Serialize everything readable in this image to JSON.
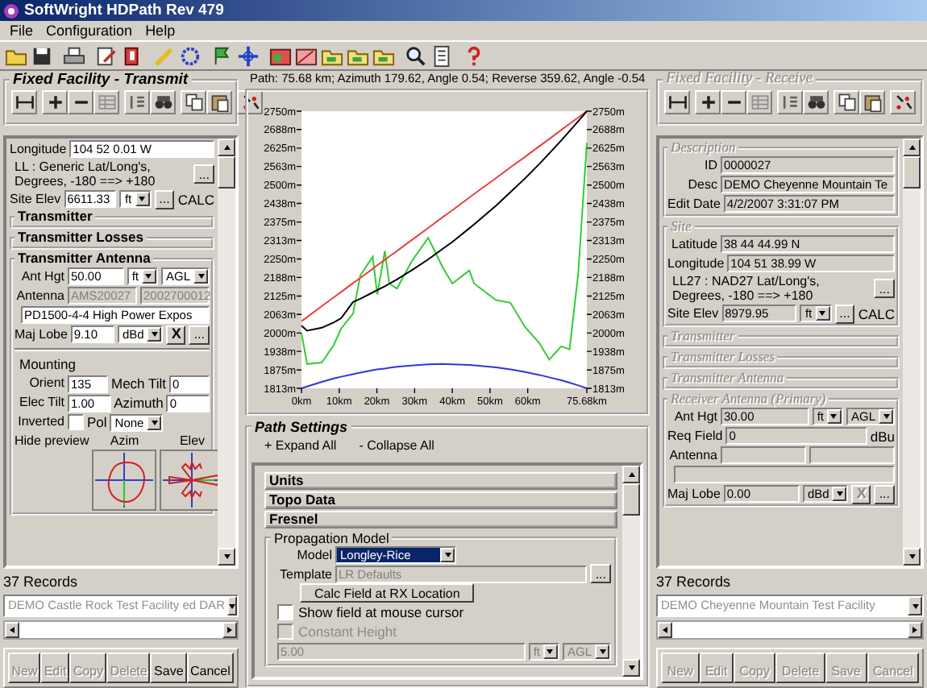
{
  "window": {
    "title": "SoftWright HDPath Rev 479"
  },
  "menu": [
    {
      "label": "File"
    },
    {
      "label": "Configuration"
    },
    {
      "label": "Help"
    }
  ],
  "transmit": {
    "title": "Fixed Facility - Transmit",
    "disabled": false,
    "blocks": [
      {
        "kind": "plain",
        "rows": [
          {
            "kind": "field",
            "label": "Longitude",
            "controls": [
              {
                "kind": "input",
                "value": "104 52 0.01 W",
                "disabled": false
              }
            ]
          },
          {
            "kind": "note",
            "text": "LL : Generic Lat/Long's, Degrees, -180 ==> +180",
            "button": "..."
          },
          {
            "kind": "field",
            "label": "Site Elev",
            "controls": [
              {
                "kind": "input",
                "value": "6611.33",
                "disabled": false
              },
              {
                "kind": "select",
                "value": "ft",
                "disabled": false,
                "focused": false
              },
              {
                "kind": "browse",
                "label": "...",
                "disabled": false
              },
              {
                "kind": "text",
                "text": "CALC"
              }
            ]
          }
        ]
      },
      {
        "kind": "section",
        "title": "Transmitter",
        "expanded": false
      },
      {
        "kind": "section",
        "title": "Transmitter Losses",
        "expanded": false
      },
      {
        "kind": "section",
        "title": "Transmitter Antenna",
        "expanded": true,
        "rows": [
          {
            "kind": "field",
            "label": "Ant Hgt",
            "controls": [
              {
                "kind": "input",
                "value": "50.00",
                "disabled": false
              },
              {
                "kind": "select",
                "value": "ft",
                "disabled": false,
                "focused": false
              },
              {
                "kind": "select",
                "value": "AGL",
                "disabled": false,
                "focused": false
              }
            ]
          },
          {
            "kind": "field",
            "label": "Antenna",
            "controls": [
              {
                "kind": "input",
                "value": "AMS20027",
                "disabled": true
              },
              {
                "kind": "input",
                "value": "2002700012",
                "disabled": true
              }
            ]
          },
          {
            "kind": "field",
            "controls": [
              {
                "kind": "input",
                "value": "PD1500-4-4 High Power Expos",
                "disabled": false
              }
            ]
          },
          {
            "kind": "field",
            "label": "Maj Lobe",
            "controls": [
              {
                "kind": "input",
                "value": "9.10",
                "disabled": false
              },
              {
                "kind": "select",
                "value": "dBd",
                "disabled": false,
                "focused": false
              },
              {
                "kind": "clear",
                "label": "X",
                "disabled": false
              },
              {
                "kind": "browse",
                "label": "...",
                "disabled": false
              }
            ]
          },
          {
            "kind": "divider"
          },
          {
            "kind": "heading",
            "text": "Mounting"
          },
          {
            "kind": "field",
            "label": "Orient",
            "controls": [
              {
                "kind": "input",
                "value": "135",
                "disabled": false
              },
              {
                "kind": "text",
                "text": "Mech Tilt"
              },
              {
                "kind": "input",
                "value": "0",
                "disabled": false
              }
            ]
          },
          {
            "kind": "field",
            "label": "Elec Tilt",
            "controls": [
              {
                "kind": "input",
                "value": "1.00",
                "disabled": false
              },
              {
                "kind": "text",
                "text": "Azimuth"
              },
              {
                "kind": "input",
                "value": "0",
                "disabled": false
              }
            ]
          },
          {
            "kind": "field",
            "label": "Inverted",
            "controls": [
              {
                "kind": "check",
                "checked": false,
                "disabled": false
              },
              {
                "kind": "text",
                "text": "Pol"
              },
              {
                "kind": "select",
                "value": "None",
                "disabled": false,
                "focused": false
              }
            ]
          },
          {
            "kind": "preview",
            "link": "Hide preview",
            "captions": [
              "Azim",
              "Elev"
            ]
          }
        ]
      }
    ],
    "records": {
      "count": "37 Records",
      "current": "DEMO Castle Rock Test Facility ed DAR",
      "disabled": true,
      "buttons": [
        {
          "label": "New",
          "disabled": true
        },
        {
          "label": "Edit",
          "disabled": true
        },
        {
          "label": "Copy",
          "disabled": true
        },
        {
          "label": "Delete",
          "disabled": true
        },
        {
          "label": "Save",
          "disabled": false
        },
        {
          "label": "Cancel",
          "disabled": false
        }
      ]
    }
  },
  "path": {
    "summary": "Path: 75.68 km; Azimuth 179.62, Angle 0.54; Reverse 359.62, Angle -0.54",
    "chart_data": {
      "type": "line",
      "x": [
        0,
        1.5,
        5.4,
        8.6,
        10.5,
        13.7,
        15.6,
        18.9,
        20.1,
        22.1,
        23.3,
        25.3,
        29.1,
        33.6,
        37.5,
        40,
        44.5,
        45.8,
        51.6,
        55.4,
        59.3,
        63.1,
        65.7,
        68.9,
        71.1,
        73.4,
        75.68
      ],
      "series": [
        {
          "color": "#33cc33",
          "values": [
            2000,
            1895,
            1900,
            1960,
            2015,
            2065,
            2195,
            2258,
            2130,
            2277,
            2167,
            2150,
            2240,
            2322,
            2221,
            2167,
            2212,
            2167,
            2111,
            2102,
            2020,
            1965,
            1910,
            1955,
            1945,
            2202,
            2643
          ]
        },
        {
          "color": "#e84040",
          "values": [
            2040,
            2054,
            2091,
            2121,
            2139,
            2169,
            2186,
            2217,
            2229,
            2247,
            2259,
            2277,
            2313,
            2355,
            2392,
            2415,
            2458,
            2470,
            2524,
            2560,
            2596,
            2632,
            2656,
            2686,
            2707,
            2729,
            2750
          ]
        },
        {
          "color": "#000000",
          "values": [
            2025,
            2008,
            2018,
            2036,
            2050,
            2105,
            2116,
            2137,
            2145,
            2158,
            2167,
            2181,
            2211,
            2249,
            2285,
            2308,
            2354,
            2367,
            2431,
            2476,
            2523,
            2572,
            2607,
            2651,
            2683,
            2716,
            2750
          ]
        },
        {
          "color": "#3333dd",
          "values": [
            1813,
            1819,
            1835,
            1846,
            1852,
            1861,
            1866,
            1874,
            1877,
            1880,
            1883,
            1886,
            1890,
            1894,
            1895,
            1894,
            1892,
            1891,
            1884,
            1877,
            1868,
            1858,
            1850,
            1840,
            1832,
            1823,
            1813
          ]
        }
      ],
      "xlim": [
        0,
        75.68
      ],
      "ylim": [
        1813,
        2750
      ],
      "xticks": [
        {
          "value": 0,
          "label": "0km"
        },
        {
          "value": 10,
          "label": "10km"
        },
        {
          "value": 20,
          "label": "20km"
        },
        {
          "value": 30,
          "label": "30km"
        },
        {
          "value": 40,
          "label": "40km"
        },
        {
          "value": 50,
          "label": "50km"
        },
        {
          "value": 60,
          "label": "60km"
        },
        {
          "value": 75.68,
          "label": "75.68km"
        }
      ],
      "yticks": [
        {
          "value": 1813,
          "label": "1813m"
        },
        {
          "value": 1875,
          "label": "1875m"
        },
        {
          "value": 1938,
          "label": "1938m"
        },
        {
          "value": 2000,
          "label": "2000m"
        },
        {
          "value": 2063,
          "label": "2063m"
        },
        {
          "value": 2125,
          "label": "2125m"
        },
        {
          "value": 2188,
          "label": "2188m"
        },
        {
          "value": 2250,
          "label": "2250m"
        },
        {
          "value": 2313,
          "label": "2313m"
        },
        {
          "value": 2375,
          "label": "2375m"
        },
        {
          "value": 2438,
          "label": "2438m"
        },
        {
          "value": 2500,
          "label": "2500m"
        },
        {
          "value": 2563,
          "label": "2563m"
        },
        {
          "value": 2625,
          "label": "2625m"
        },
        {
          "value": 2688,
          "label": "2688m"
        },
        {
          "value": 2750,
          "label": "2750m"
        }
      ]
    },
    "settings": {
      "title": "Path Settings",
      "links": [
        "+ Expand All",
        "- Collapse All"
      ],
      "sections": [
        {
          "title": "Units",
          "expanded": false
        },
        {
          "title": "Topo Data",
          "expanded": false
        },
        {
          "title": "Fresnel",
          "expanded": false
        },
        {
          "title": "Propagation Model",
          "expanded": true,
          "rows": [
            {
              "kind": "field",
              "label": "Model",
              "controls": [
                {
                  "kind": "select",
                  "value": "Longley-Rice",
                  "disabled": false,
                  "focused": true
                }
              ]
            },
            {
              "kind": "field",
              "label": "Template",
              "controls": [
                {
                  "kind": "input",
                  "value": "LR Defaults",
                  "disabled": true
                },
                {
                  "kind": "browse",
                  "label": "...",
                  "disabled": false
                }
              ]
            },
            {
              "kind": "field",
              "controls": [
                {
                  "kind": "action",
                  "label": "Calc Field at RX Location",
                  "disabled": false
                }
              ]
            },
            {
              "kind": "field",
              "controls": [
                {
                  "kind": "check",
                  "label": "Show field at mouse cursor",
                  "checked": false,
                  "disabled": false
                }
              ]
            },
            {
              "kind": "field",
              "controls": [
                {
                  "kind": "check",
                  "label": "Constant Height",
                  "checked": false,
                  "disabled": true
                }
              ]
            },
            {
              "kind": "field",
              "controls": [
                {
                  "kind": "input",
                  "value": "5.00",
                  "disabled": true
                },
                {
                  "kind": "select",
                  "value": "ft",
                  "disabled": true,
                  "focused": false
                },
                {
                  "kind": "select",
                  "value": "AGL",
                  "disabled": true,
                  "focused": false
                }
              ]
            }
          ]
        }
      ]
    }
  },
  "receive": {
    "title": "Fixed Facility - Receive",
    "disabled": true,
    "blocks": [
      {
        "kind": "section",
        "title": "Description",
        "expanded": true,
        "rows": [
          {
            "kind": "field",
            "label": "ID",
            "controls": [
              {
                "kind": "input",
                "value": "0000027",
                "disabled": false
              }
            ]
          },
          {
            "kind": "field",
            "label": "Desc",
            "controls": [
              {
                "kind": "input",
                "value": "DEMO Cheyenne Mountain Te",
                "disabled": false
              }
            ]
          },
          {
            "kind": "field",
            "label": "Edit Date",
            "controls": [
              {
                "kind": "input",
                "value": "4/2/2007 3:31:07 PM",
                "disabled": false
              }
            ]
          }
        ]
      },
      {
        "kind": "section",
        "title": "Site",
        "expanded": true,
        "rows": [
          {
            "kind": "field",
            "label": "Latitude",
            "controls": [
              {
                "kind": "input",
                "value": "38 44 44.99 N",
                "disabled": false
              }
            ]
          },
          {
            "kind": "field",
            "label": "Longitude",
            "controls": [
              {
                "kind": "input",
                "value": "104 51 38.99 W",
                "disabled": false
              }
            ]
          },
          {
            "kind": "note",
            "text": "LL27 : NAD27 Lat/Long's, Degrees, -180 ==> +180",
            "button": "..."
          },
          {
            "kind": "field",
            "label": "Site Elev",
            "controls": [
              {
                "kind": "input",
                "value": "8979.95",
                "disabled": false
              },
              {
                "kind": "select",
                "value": "ft",
                "disabled": false,
                "focused": false
              },
              {
                "kind": "browse",
                "label": "...",
                "disabled": false
              },
              {
                "kind": "text",
                "text": "CALC"
              }
            ]
          }
        ]
      },
      {
        "kind": "section",
        "title": "Transmitter",
        "expanded": false
      },
      {
        "kind": "section",
        "title": "Transmitter Losses",
        "expanded": false
      },
      {
        "kind": "section",
        "title": "Transmitter Antenna",
        "expanded": false
      },
      {
        "kind": "section",
        "title": "Receiver Antenna (Primary)",
        "expanded": true,
        "rows": [
          {
            "kind": "field",
            "label": "Ant Hgt",
            "controls": [
              {
                "kind": "input",
                "value": "30.00",
                "disabled": false
              },
              {
                "kind": "select",
                "value": "ft",
                "disabled": false,
                "focused": false
              },
              {
                "kind": "select",
                "value": "AGL",
                "disabled": false,
                "focused": false
              }
            ]
          },
          {
            "kind": "field",
            "label": "Req Field",
            "controls": [
              {
                "kind": "input",
                "value": "0",
                "disabled": false
              },
              {
                "kind": "text",
                "text": "dBu"
              }
            ]
          },
          {
            "kind": "field",
            "label": "Antenna",
            "controls": [
              {
                "kind": "input",
                "disabled": false
              },
              {
                "kind": "input",
                "disabled": false
              }
            ]
          },
          {
            "kind": "field",
            "controls": [
              {
                "kind": "input",
                "disabled": false
              }
            ]
          },
          {
            "kind": "field",
            "label": "Maj Lobe",
            "controls": [
              {
                "kind": "input",
                "value": "0.00",
                "disabled": false
              },
              {
                "kind": "select",
                "value": "dBd",
                "disabled": false,
                "focused": false
              },
              {
                "kind": "clear",
                "label": "X",
                "disabled": true
              },
              {
                "kind": "browse",
                "label": "...",
                "disabled": false
              }
            ]
          }
        ]
      }
    ],
    "records": {
      "count": "37 Records",
      "current": "DEMO Cheyenne Mountain Test Facility",
      "disabled": true,
      "buttons": [
        {
          "label": "New",
          "disabled": true
        },
        {
          "label": "Edit",
          "disabled": true
        },
        {
          "label": "Copy",
          "disabled": true
        },
        {
          "label": "Delete",
          "disabled": true
        },
        {
          "label": "Save",
          "disabled": true
        },
        {
          "label": "Cancel",
          "disabled": true
        }
      ]
    }
  }
}
